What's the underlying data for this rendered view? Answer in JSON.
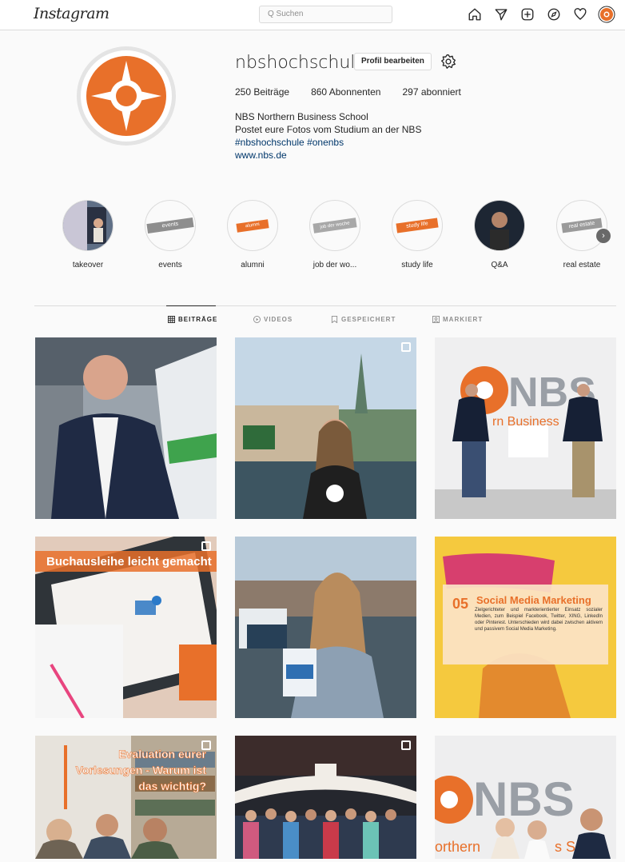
{
  "topbar": {
    "logo": "Instagram",
    "search_placeholder": "Q Suchen",
    "icons": [
      "home-icon",
      "direct-icon",
      "new-post-icon",
      "explore-icon",
      "activity-icon",
      "profile-avatar-icon"
    ]
  },
  "profile": {
    "username": "nbshochschule",
    "edit_button": "Profil bearbeiten",
    "stats": {
      "posts": "250 Beiträge",
      "followers": "860 Abonnenten",
      "following": "297 abonniert"
    },
    "bio": {
      "name": "NBS Northern Business School",
      "line1": "Postet eure Fotos vom Studium an der NBS",
      "hashtags": "#nbshochschule #onenbs",
      "link": "www.nbs.de"
    },
    "brand_color": "#e8702a"
  },
  "highlights": [
    {
      "label": "takeover",
      "thumb": ""
    },
    {
      "label": "events",
      "thumb": "events"
    },
    {
      "label": "alumni",
      "thumb": "alumni"
    },
    {
      "label": "job der wo...",
      "thumb": "job der woche"
    },
    {
      "label": "study life",
      "thumb": "study life"
    },
    {
      "label": "Q&A",
      "thumb": ""
    },
    {
      "label": "real estate",
      "thumb": "real estate"
    }
  ],
  "tabs": [
    {
      "label": "BEITRÄGE",
      "active": true
    },
    {
      "label": "VIDEOS",
      "active": false
    },
    {
      "label": "GESPEICHERT",
      "active": false
    },
    {
      "label": "MARKIERT",
      "active": false
    }
  ],
  "posts": {
    "p4_text": "Buchausleihe leicht gemacht",
    "p6_num": "05",
    "p6_title": "Social Media Marketing",
    "p6_body": "Zielgerichteter und markterientierter Einsatz sozialer Medien, zum Beispiel Facebook, Twitter, XING, LinkedIn oder Pinterest. Unterschieden wird dabei zwischen aktivem und passivem Social Media Marketing.",
    "p7_line1": "Evaluation eurer",
    "p7_line2": "Vorlesungen - Warum ist",
    "p7_line3": "das wichtig?",
    "p3_sign": "NBS",
    "p3_sub": "rn Business",
    "p9_sign": "NBS",
    "p9_sub": "orthern",
    "p9_sub2": "s S"
  }
}
